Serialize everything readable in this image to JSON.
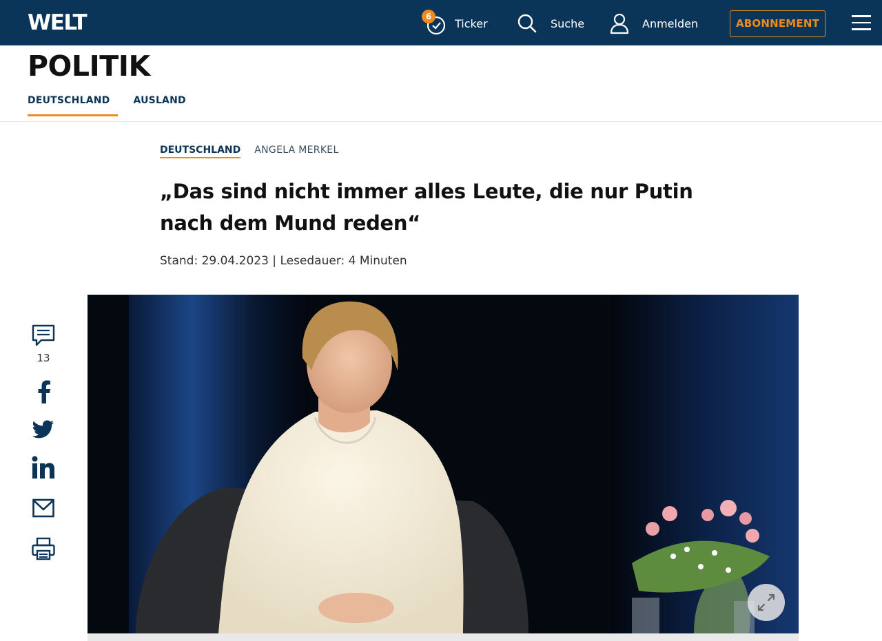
{
  "header": {
    "logo": "WELT",
    "ticker": {
      "label": "Ticker",
      "badge": "6"
    },
    "search": {
      "label": "Suche"
    },
    "login": {
      "label": "Anmelden"
    },
    "subscribe": "ABONNEMENT"
  },
  "section": {
    "title": "POLITIK",
    "tabs": [
      {
        "label": "DEUTSCHLAND",
        "active": true
      },
      {
        "label": "AUSLAND",
        "active": false
      }
    ]
  },
  "article": {
    "tags": [
      "DEUTSCHLAND",
      "ANGELA MERKEL"
    ],
    "headline": "„Das sind nicht immer alles Leute, die nur Putin nach dem Mund reden“",
    "meta": "Stand: 29.04.2023 | Lesedauer: 4 Minuten"
  },
  "social": {
    "comments_count": "13",
    "icons": [
      "comment-icon",
      "facebook-icon",
      "twitter-icon",
      "linkedin-icon",
      "mail-icon",
      "print-icon"
    ]
  },
  "colors": {
    "navy": "#0b3558",
    "accent": "#f08a1d"
  }
}
